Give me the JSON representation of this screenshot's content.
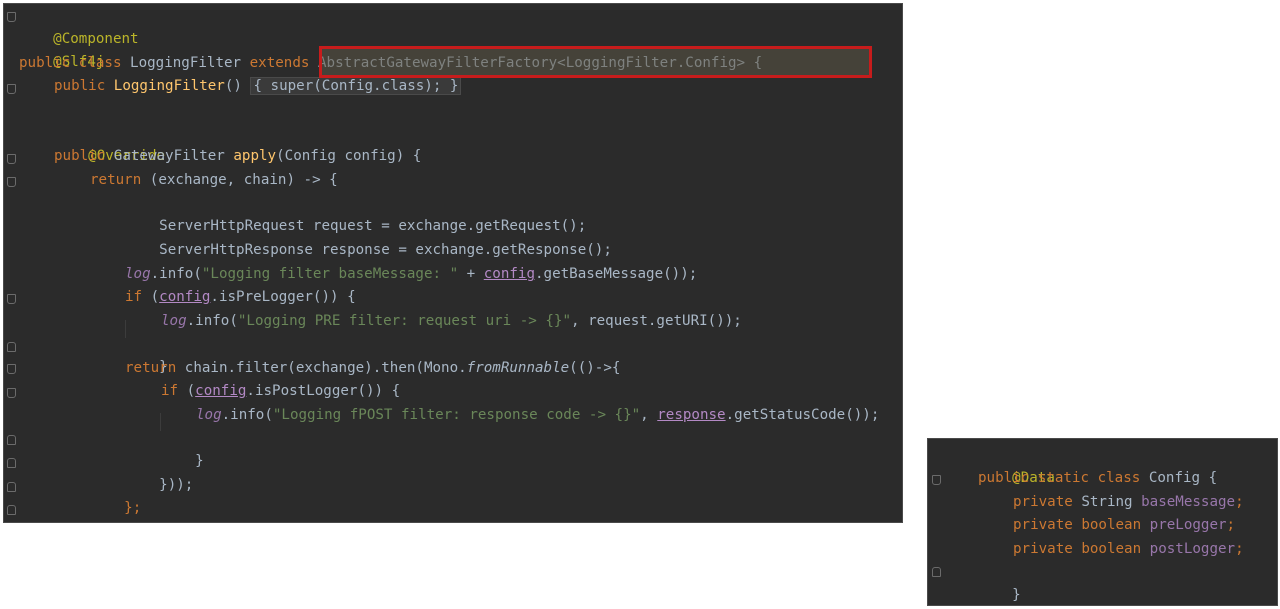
{
  "main_code": {
    "l1": "@Component",
    "l2": "@Slf4j",
    "l3_kw": "public class ",
    "l3_name": "LoggingFilter ",
    "l3_ext": "extends ",
    "l3_super": "AbstractGatewayFilterFactory<LoggingFilter.Config> {",
    "l4_kw": "public ",
    "l4_fn": "LoggingFilter",
    "l4_paren": "() ",
    "l4_fold": "{ super(Config.class); }",
    "l5_ann": "@Override",
    "l6_kw": "public ",
    "l6_type": "GatewayFilter ",
    "l6_fn": "apply",
    "l6_rest": "(Config config) {",
    "l7_kw": "return ",
    "l7_rest": "(exchange, chain) -> {",
    "l8": "ServerHttpRequest request = exchange.getRequest();",
    "l9": "ServerHttpResponse response = exchange.getResponse();",
    "l10_log": "log",
    "l10_a": ".info(",
    "l10_str": "\"Logging filter baseMessage: \"",
    "l10_b": " + ",
    "l10_cfg": "config",
    "l10_c": ".getBaseMessage());",
    "l11_kw": "if ",
    "l11_a": "(",
    "l11_cfg": "config",
    "l11_b": ".isPreLogger()) {",
    "l12_log": "log",
    "l12_a": ".info(",
    "l12_str": "\"Logging PRE filter: request uri -> {}\"",
    "l12_b": ", request.getURI());",
    "l13": "}",
    "l14_kw": "return ",
    "l14_a": "chain.filter(exchange).then(Mono.",
    "l14_it": "fromRunnable",
    "l14_b": "(()->{",
    "l15_kw": "if ",
    "l15_a": "(",
    "l15_cfg": "config",
    "l15_b": ".isPostLogger()) {",
    "l16_log": "log",
    "l16_a": ".info(",
    "l16_str": "\"Logging fPOST filter: response code -> {}\"",
    "l16_b": ", ",
    "l16_resp": "response",
    "l16_c": ".getStatusCode());",
    "l17": "}",
    "l18": "}));",
    "l19": "};",
    "l20": "}"
  },
  "config_code": {
    "l1": "@Data",
    "l2_kw": "public static class ",
    "l2_rest": "Config {",
    "l3_kw": "private ",
    "l3_type": "String ",
    "l3_field": "baseMessage",
    "l3_semi": ";",
    "l4_kw": "private boolean ",
    "l4_field": "preLogger",
    "l4_semi": ";",
    "l5_kw": "private boolean ",
    "l5_field": "postLogger",
    "l5_semi": ";",
    "l6": "}",
    "l7": "}"
  },
  "colors": {
    "editor_bg": "#2b2b2b",
    "keyword": "#cc7832",
    "annotation": "#bbb529",
    "function": "#ffc66d",
    "string": "#6a8759",
    "field": "#9876aa",
    "highlight_border": "#c71c1c"
  }
}
